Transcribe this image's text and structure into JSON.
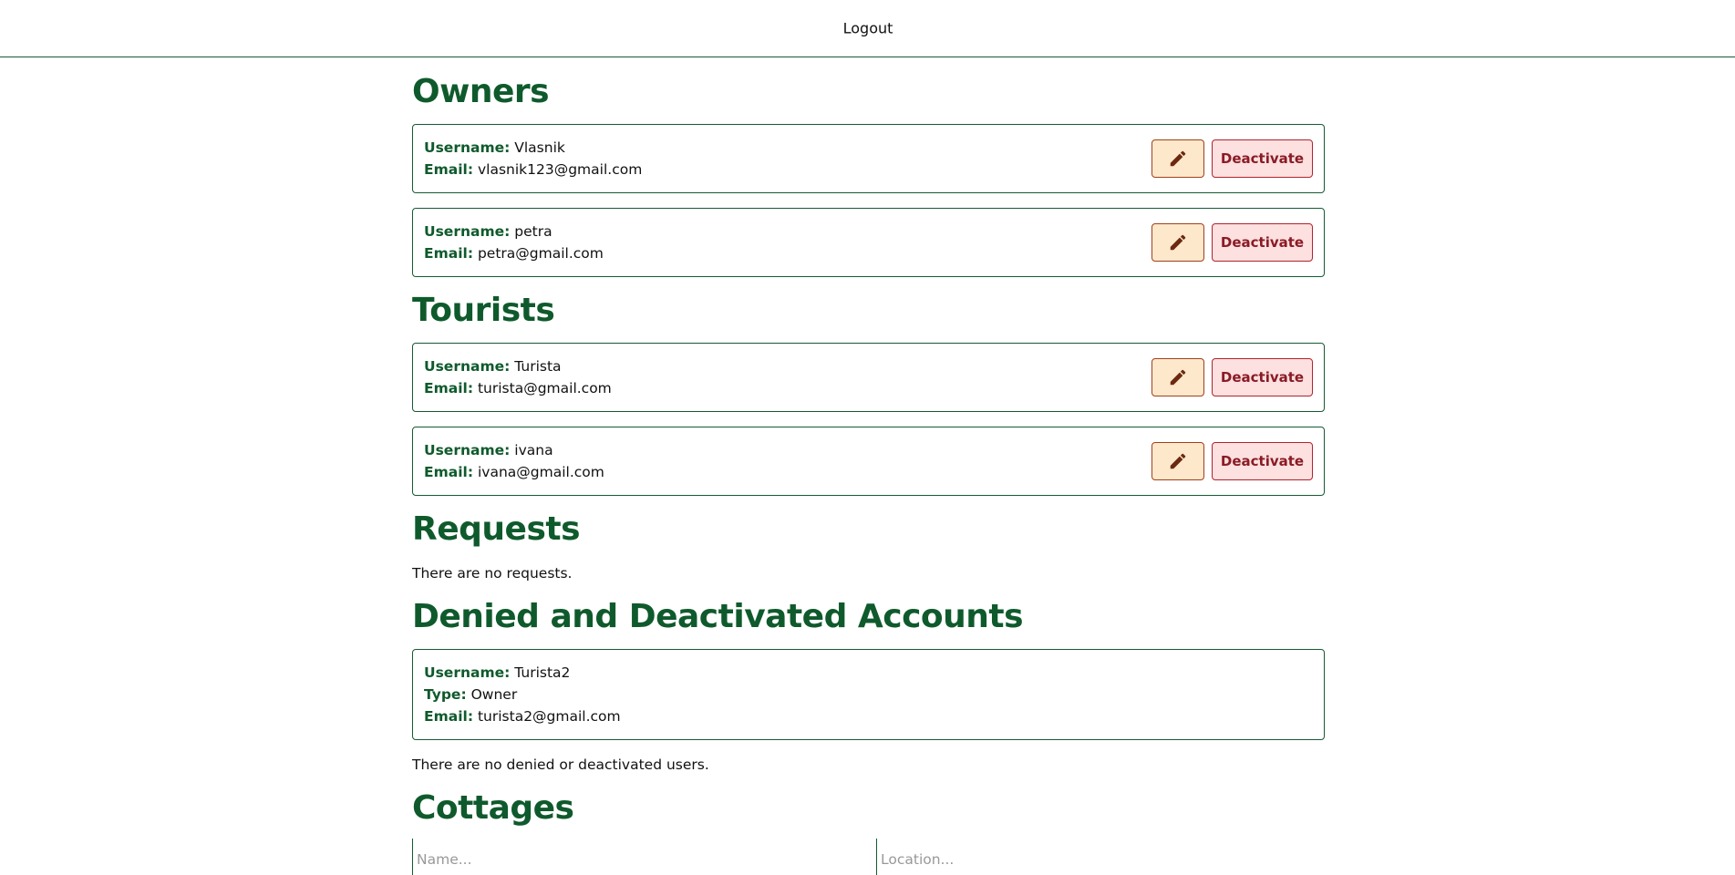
{
  "topbar": {
    "logout_label": "Logout"
  },
  "sections": {
    "owners": {
      "title": "Owners",
      "items": [
        {
          "username": "Vlasnik",
          "email": "vlasnik123@gmail.com"
        },
        {
          "username": "petra",
          "email": "petra@gmail.com"
        }
      ]
    },
    "tourists": {
      "title": "Tourists",
      "items": [
        {
          "username": "Turista",
          "email": "turista@gmail.com"
        },
        {
          "username": "ivana",
          "email": "ivana@gmail.com"
        }
      ]
    },
    "requests": {
      "title": "Requests",
      "empty_text": "There are no requests."
    },
    "denied": {
      "title": "Denied and Deactivated Accounts",
      "items": [
        {
          "username": "Turista2",
          "type": "Owner",
          "email": "turista2@gmail.com"
        }
      ],
      "empty_text": "There are no denied or deactivated users."
    },
    "cottages": {
      "title": "Cottages",
      "name_placeholder": "Name...",
      "location_placeholder": "Location..."
    }
  },
  "labels": {
    "username": "Username:",
    "email": "Email:",
    "type": "Type:",
    "deactivate": "Deactivate"
  },
  "icons": {
    "edit": "edit-pencil-icon"
  },
  "colors": {
    "heading": "#0f5a2c",
    "border": "#165a33",
    "edit_bg": "#fde8cc",
    "deactivate_bg": "#fde0e0",
    "deactivate_text": "#8a1b25"
  }
}
